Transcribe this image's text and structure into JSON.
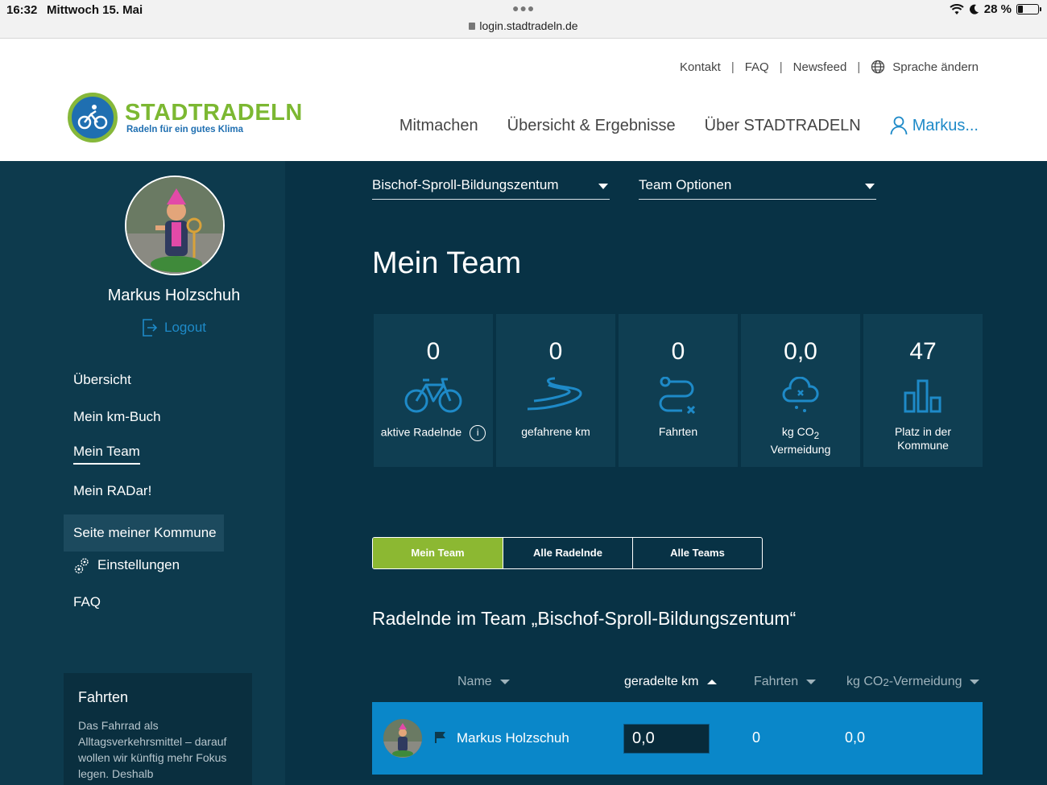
{
  "statusbar": {
    "time": "16:32",
    "date": "Mittwoch 15. Mai",
    "url": "login.stadtradeln.de",
    "battery": "28 %",
    "battery_level_percent": 28
  },
  "header": {
    "links": [
      "Kontakt",
      "FAQ",
      "Newsfeed"
    ],
    "language_label": "Sprache ändern",
    "logo_title": "STADTRADELN",
    "logo_sub": "Radeln für ein gutes Klima",
    "nav": [
      "Mitmachen",
      "Übersicht & Ergebnisse",
      "Über STADTRADELN"
    ],
    "user_label": "Markus..."
  },
  "sidebar": {
    "username": "Markus Holzschuh",
    "logout": "Logout",
    "menu": [
      "Übersicht",
      "Mein km-Buch",
      "Mein Team",
      "Mein RADar!",
      "Seite meiner Kommune",
      "Einstellungen",
      "FAQ"
    ],
    "infobox": {
      "title": "Fahrten",
      "text": "Das Fahrrad als Alltagsverkehrsmittel – darauf wollen wir künftig mehr Fokus legen. Deshalb"
    }
  },
  "main": {
    "team_select": "Bischof-Sproll-Bildungszentum",
    "options_select": "Team Optionen",
    "title": "Mein Team",
    "stats": [
      {
        "value": "0",
        "label": "aktive Radelnde",
        "icon": "bicycle-icon"
      },
      {
        "value": "0",
        "label": "gefahrene km",
        "icon": "road-icon"
      },
      {
        "value": "0",
        "label": "Fahrten",
        "icon": "route-icon"
      },
      {
        "value": "0,0",
        "label_pre": "kg CO",
        "label_sub": "2",
        "label_post": "Vermeidung",
        "icon": "cloud-icon"
      },
      {
        "value": "47",
        "label": "Platz in der Kommune",
        "icon": "bar-chart-icon"
      }
    ],
    "info_symbol": "i",
    "tabs": [
      "Mein Team",
      "Alle Radelnde",
      "Alle Teams"
    ],
    "section_title": "Radelnde im Team „Bischof-Sproll-Bildungszentum“",
    "columns": {
      "name": "Name",
      "km": "geradelte km",
      "trips": "Fahrten",
      "co2_pre": "kg CO",
      "co2_sub": "2",
      "co2_post": "-Vermeidung"
    },
    "row": {
      "name": "Markus Holzschuh",
      "km": "0,0",
      "trips": "0",
      "co2": "0,0"
    }
  },
  "colors": {
    "brand_green": "#7cb832",
    "brand_blue": "#1e8ac8",
    "sidebar_bg": "#0d3a4d",
    "main_bg": "#083245",
    "row_highlight": "#0a87c9"
  }
}
